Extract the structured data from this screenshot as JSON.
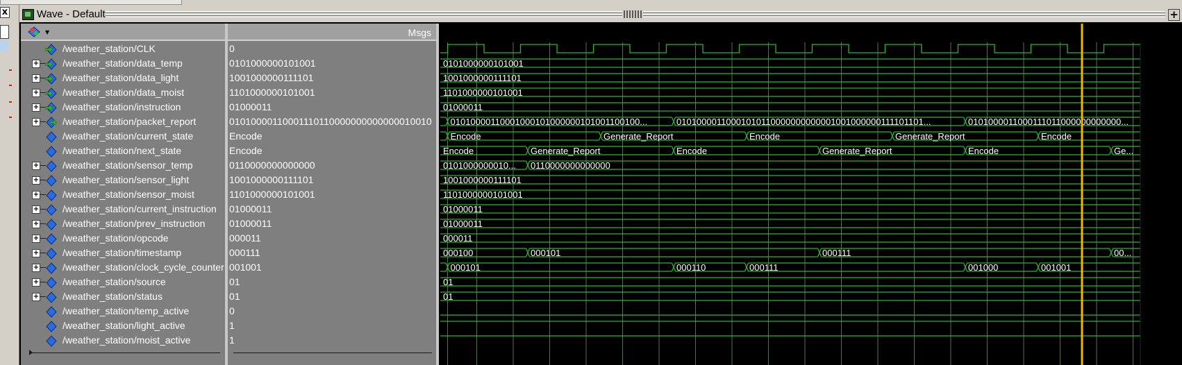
{
  "window": {
    "title": "Wave - Default",
    "add_label": "+",
    "close_label": "x"
  },
  "header": {
    "msgs_label": "Msgs"
  },
  "signals": [
    {
      "name": "/weather_station/CLK",
      "value": "0",
      "kind": "input",
      "expandable": false
    },
    {
      "name": "/weather_station/data_temp",
      "value": "0101000000101001",
      "kind": "input",
      "expandable": true
    },
    {
      "name": "/weather_station/data_light",
      "value": "1001000000111101",
      "kind": "input",
      "expandable": true
    },
    {
      "name": "/weather_station/data_moist",
      "value": "1101000000101001",
      "kind": "input",
      "expandable": true
    },
    {
      "name": "/weather_station/instruction",
      "value": "01000011",
      "kind": "input",
      "expandable": true
    },
    {
      "name": "/weather_station/packet_report",
      "value": "01010000110001110110000000000000010010...",
      "kind": "output",
      "expandable": true
    },
    {
      "name": "/weather_station/current_state",
      "value": "Encode",
      "kind": "internal",
      "expandable": false
    },
    {
      "name": "/weather_station/next_state",
      "value": "Encode",
      "kind": "internal",
      "expandable": false
    },
    {
      "name": "/weather_station/sensor_temp",
      "value": "0110000000000000",
      "kind": "internal",
      "expandable": true
    },
    {
      "name": "/weather_station/sensor_light",
      "value": "1001000000111101",
      "kind": "internal",
      "expandable": true
    },
    {
      "name": "/weather_station/sensor_moist",
      "value": "1101000000101001",
      "kind": "internal",
      "expandable": true
    },
    {
      "name": "/weather_station/current_instruction",
      "value": "01000011",
      "kind": "internal",
      "expandable": true
    },
    {
      "name": "/weather_station/prev_instruction",
      "value": "01000011",
      "kind": "internal",
      "expandable": true
    },
    {
      "name": "/weather_station/opcode",
      "value": "000011",
      "kind": "internal",
      "expandable": true
    },
    {
      "name": "/weather_station/timestamp",
      "value": "000111",
      "kind": "internal",
      "expandable": true
    },
    {
      "name": "/weather_station/clock_cycle_counter",
      "value": "001001",
      "kind": "internal",
      "expandable": true
    },
    {
      "name": "/weather_station/source",
      "value": "01",
      "kind": "internal",
      "expandable": true
    },
    {
      "name": "/weather_station/status",
      "value": "01",
      "kind": "internal",
      "expandable": true
    },
    {
      "name": "/weather_station/temp_active",
      "value": "0",
      "kind": "internal",
      "expandable": false
    },
    {
      "name": "/weather_station/light_active",
      "value": "1",
      "kind": "internal",
      "expandable": false
    },
    {
      "name": "/weather_station/moist_active",
      "value": "1",
      "kind": "internal",
      "expandable": false
    }
  ],
  "waves": [
    {
      "type": "clock"
    },
    {
      "type": "bus",
      "segs": [
        {
          "t": 0,
          "label": "0101000000101001"
        }
      ]
    },
    {
      "type": "bus",
      "segs": [
        {
          "t": 0,
          "label": "1001000000111101"
        }
      ]
    },
    {
      "type": "bus",
      "segs": [
        {
          "t": 0,
          "label": "1101000000101001"
        }
      ]
    },
    {
      "type": "bus",
      "segs": [
        {
          "t": 0,
          "label": "01000011"
        }
      ]
    },
    {
      "type": "bus",
      "segs": [
        {
          "t": 0,
          "label": ""
        },
        {
          "t": 1,
          "label": "01010000110001000101000000101001100100..."
        },
        {
          "t": 32,
          "label": "01010000110001010110000000000001001000000111101101..."
        },
        {
          "t": 72,
          "label": "0101000011000111011000000000000..."
        }
      ]
    },
    {
      "type": "bus",
      "segs": [
        {
          "t": 0,
          "label": ""
        },
        {
          "t": 1,
          "label": "Encode"
        },
        {
          "t": 22,
          "label": "Generate_Report"
        },
        {
          "t": 42,
          "label": "Encode"
        },
        {
          "t": 62,
          "label": "Generate_Report"
        },
        {
          "t": 82,
          "label": "Encode"
        }
      ]
    },
    {
      "type": "bus",
      "segs": [
        {
          "t": 0,
          "label": "Encode"
        },
        {
          "t": 12,
          "label": "Generate_Report"
        },
        {
          "t": 32,
          "label": "Encode"
        },
        {
          "t": 52,
          "label": "Generate_Report"
        },
        {
          "t": 72,
          "label": "Encode"
        },
        {
          "t": 92,
          "label": "Gen..."
        }
      ]
    },
    {
      "type": "bus",
      "segs": [
        {
          "t": 0,
          "label": "0101000000010..."
        },
        {
          "t": 12,
          "label": "0110000000000000"
        }
      ]
    },
    {
      "type": "bus",
      "segs": [
        {
          "t": 0,
          "label": "1001000000111101"
        }
      ]
    },
    {
      "type": "bus",
      "segs": [
        {
          "t": 0,
          "label": "1101000000101001"
        }
      ]
    },
    {
      "type": "bus",
      "segs": [
        {
          "t": 0,
          "label": "01000011"
        }
      ]
    },
    {
      "type": "bus",
      "segs": [
        {
          "t": 0,
          "label": "01000011"
        }
      ]
    },
    {
      "type": "bus",
      "segs": [
        {
          "t": 0,
          "label": "000011"
        }
      ]
    },
    {
      "type": "bus",
      "segs": [
        {
          "t": 0,
          "label": "000100"
        },
        {
          "t": 12,
          "label": "000101"
        },
        {
          "t": 52,
          "label": "000111"
        },
        {
          "t": 92,
          "label": "001..."
        }
      ]
    },
    {
      "type": "bus",
      "segs": [
        {
          "t": 0,
          "label": ""
        },
        {
          "t": 1,
          "label": "000101"
        },
        {
          "t": 32,
          "label": "000110"
        },
        {
          "t": 42,
          "label": "000111"
        },
        {
          "t": 72,
          "label": "001000"
        },
        {
          "t": 82,
          "label": "001001"
        }
      ]
    },
    {
      "type": "bus",
      "segs": [
        {
          "t": 0,
          "label": "01"
        }
      ]
    },
    {
      "type": "bus",
      "segs": [
        {
          "t": 0,
          "label": "01"
        }
      ]
    },
    {
      "type": "low"
    },
    {
      "type": "high"
    },
    {
      "type": "high"
    }
  ],
  "colors": {
    "wave": "#2db52d",
    "cursor": "#f0b800",
    "grid": "#5a6e5a",
    "input_icon": "#2a6be0",
    "output_icon": "#2a6be0",
    "arrow_green": "#30b030"
  },
  "timeline": {
    "end": 96,
    "cursor": 88
  }
}
